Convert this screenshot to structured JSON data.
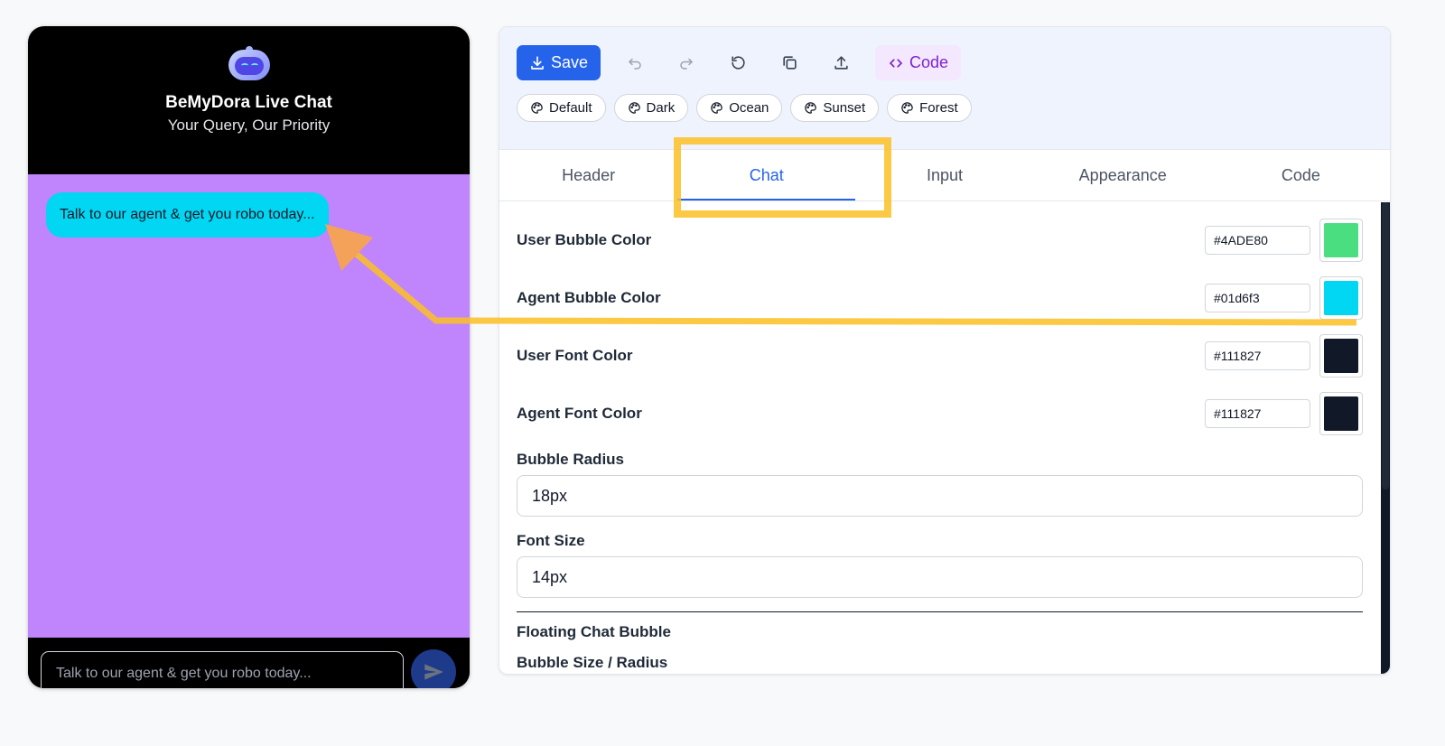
{
  "chat_preview": {
    "title": "BeMyDora Live Chat",
    "subtitle": "Your Query, Our Priority",
    "agent_message": "Talk to our agent & get you robo today...",
    "input_placeholder": "Talk to our agent & get you robo today...",
    "send_icon": "send-icon",
    "avatar_icon": "robot-icon",
    "colors": {
      "header_bg": "#000000",
      "body_bg": "#c084fc",
      "agent_bubble": "#01d6f3"
    }
  },
  "toolbar": {
    "save_label": "Save",
    "code_label": "Code",
    "icons": [
      "download-icon",
      "undo-icon",
      "redo-icon",
      "reset-icon",
      "copy-icon",
      "upload-icon",
      "code-icon"
    ],
    "themes": [
      "Default",
      "Dark",
      "Ocean",
      "Sunset",
      "Forest"
    ]
  },
  "tabs": [
    {
      "label": "Header"
    },
    {
      "label": "Chat",
      "active": true
    },
    {
      "label": "Input"
    },
    {
      "label": "Appearance"
    },
    {
      "label": "Code"
    }
  ],
  "chat_settings": {
    "user_bubble_color": {
      "label": "User Bubble Color",
      "value": "#4ADE80",
      "swatch": "#4ADE80"
    },
    "agent_bubble_color": {
      "label": "Agent Bubble Color",
      "value": "#01d6f3",
      "swatch": "#01d6f3"
    },
    "user_font_color": {
      "label": "User Font Color",
      "value": "#111827",
      "swatch": "#111827"
    },
    "agent_font_color": {
      "label": "Agent Font Color",
      "value": "#111827",
      "swatch": "#111827"
    },
    "bubble_radius": {
      "label": "Bubble Radius",
      "value": "18px"
    },
    "font_size": {
      "label": "Font Size",
      "value": "14px"
    },
    "floating_section_title": "Floating Chat Bubble",
    "bubble_size_label": "Bubble Size / Radius"
  },
  "colors": {
    "accent": "#2563eb",
    "annotation": "#fbbf24"
  }
}
